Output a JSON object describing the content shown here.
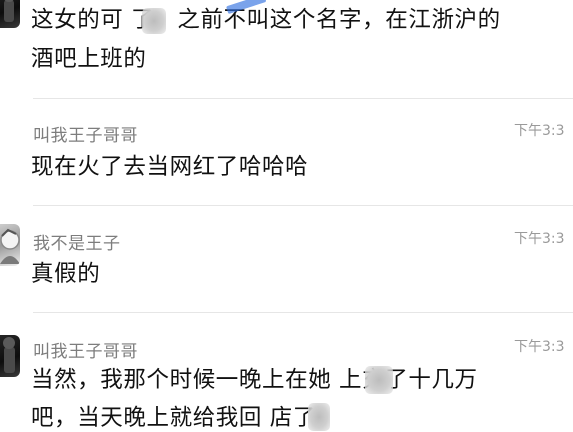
{
  "messages": [
    {
      "username": "",
      "timestamp": "",
      "lines": [
        "这女的可 了，之前不叫这个名字，在江浙沪的",
        "酒吧上班的"
      ]
    },
    {
      "username": "叫我王子哥哥",
      "timestamp": "下午3:3",
      "lines": [
        "现在火了去当网红了哈哈哈"
      ]
    },
    {
      "username": "我不是王子",
      "timestamp": "下午3:3",
      "lines": [
        "真假的"
      ]
    },
    {
      "username": "叫我王子哥哥",
      "timestamp": "下午3:3",
      "lines": [
        "当然，我那个时候一晚上在她  上充了十几万",
        "吧，当天晚上就给我回 店了"
      ]
    }
  ],
  "colors": {
    "username": "#7d7d7d",
    "timestamp": "#9a9a9a",
    "message_text": "#111111",
    "separator": "#e6e6e6",
    "watermark": "#2f6fe0"
  },
  "icons": [
    "user-avatar-icon",
    "user-avatar-icon",
    "user-avatar-icon",
    "user-avatar-icon"
  ]
}
